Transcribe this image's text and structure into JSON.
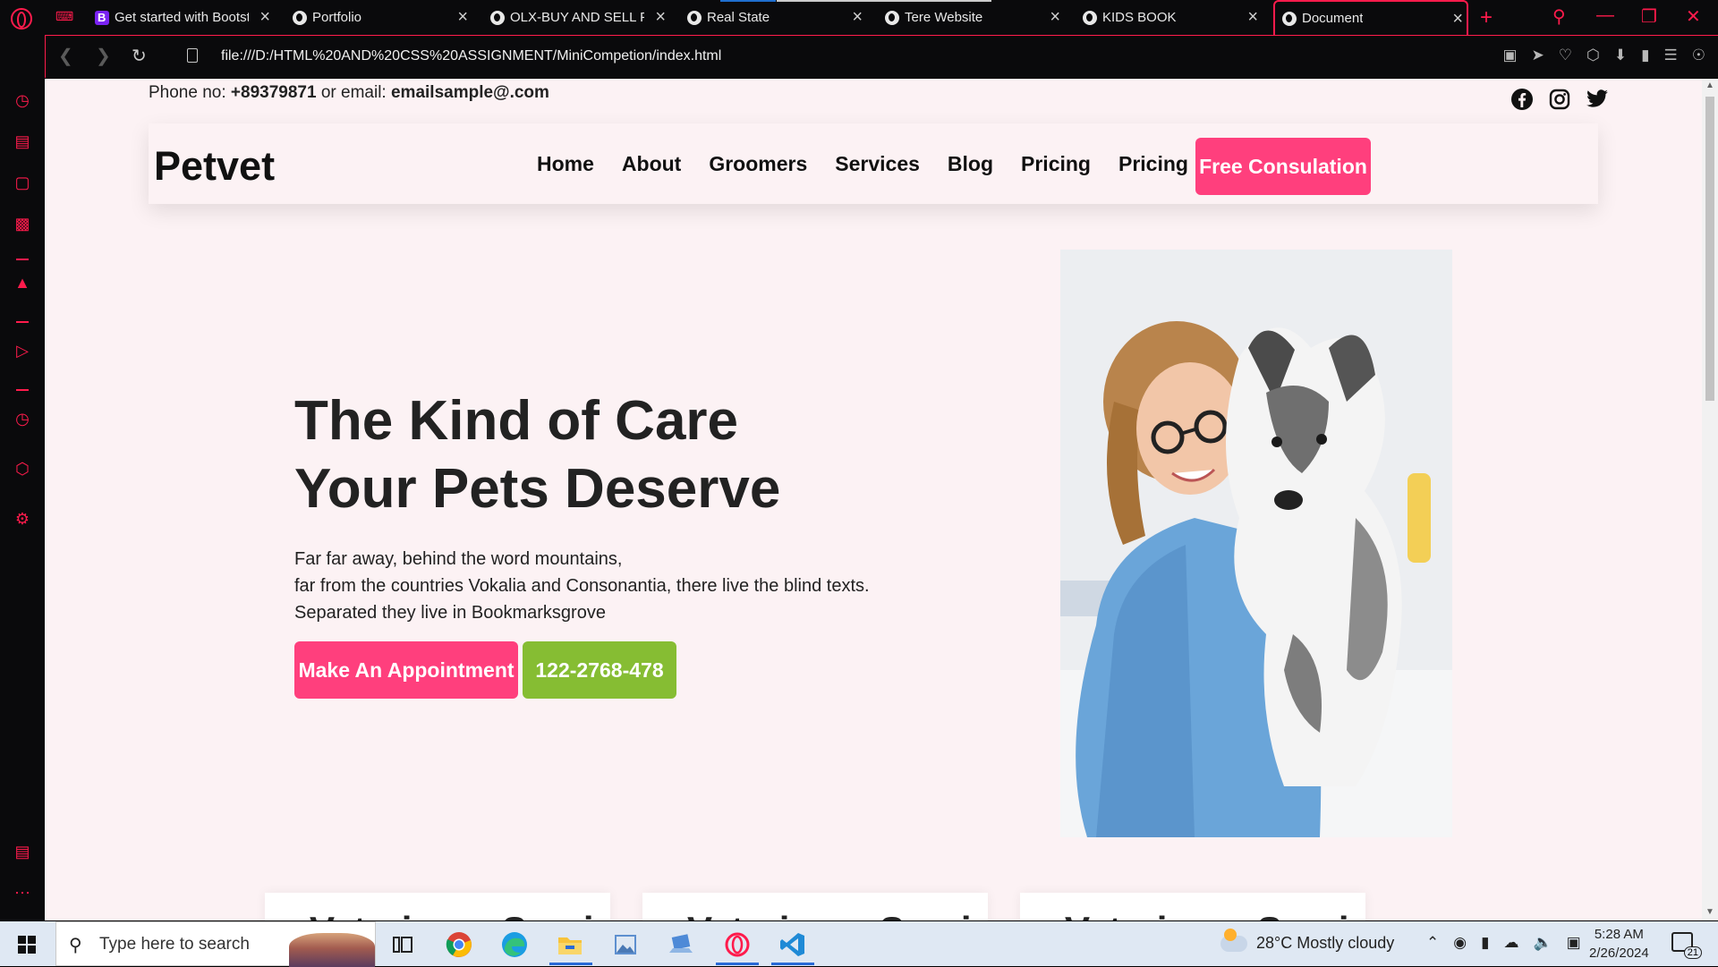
{
  "browser": {
    "tabs": [
      {
        "label": "Get started with Bootst",
        "favicon": "bootstrap-icon"
      },
      {
        "label": "Portfolio",
        "favicon": "globe-icon"
      },
      {
        "label": "OLX-BUY AND SELL FO",
        "favicon": "globe-icon"
      },
      {
        "label": "Real State",
        "favicon": "globe-icon"
      },
      {
        "label": "Tere Website",
        "favicon": "globe-icon"
      },
      {
        "label": "KIDS BOOK",
        "favicon": "globe-icon"
      },
      {
        "label": "Document",
        "favicon": "globe-icon",
        "active": true
      }
    ],
    "url": "file:///D:/HTML%20AND%20CSS%20ASSIGNMENT/MiniCompetion/index.html",
    "accent": "#ff1b4c"
  },
  "site": {
    "contact": {
      "phone_prefix": "Phone no: ",
      "phone": "+89379871",
      "email_prefix": " or email: ",
      "email": "emailsample@.com"
    },
    "socials": [
      "facebook-icon",
      "instagram-icon",
      "twitter-icon"
    ],
    "brand": "Petvet",
    "menu": [
      "Home",
      "About",
      "Groomers",
      "Services",
      "Blog",
      "Pricing",
      "Pricing"
    ],
    "cta": "Free Consulation",
    "hero": {
      "title_line1": "The Kind of Care",
      "title_line2": "Your Pets Deserve",
      "text_line1": "Far far away, behind the word mountains,",
      "text_line2": "far from the countries Vokalia and Consonantia, there live the blind texts.",
      "text_line3": "Separated they live in Bookmarksgrove",
      "btn_appointment": "Make An Appointment",
      "btn_phone": "122-2768-478"
    },
    "cards": [
      "Veterinary Services",
      "Veterinary Services",
      "Veterinary Services"
    ],
    "colors": {
      "pink": "#ff3f7d",
      "green": "#86bd33",
      "background": "#fcf2f4"
    }
  },
  "taskbar": {
    "search_placeholder": "Type here to search",
    "weather": "28°C  Mostly cloudy",
    "time": "5:28 AM",
    "date": "2/26/2024",
    "notifications": "21"
  }
}
